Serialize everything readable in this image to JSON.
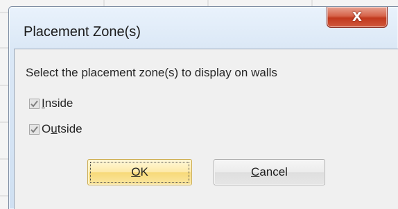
{
  "dialog": {
    "title": "Placement Zone(s)",
    "close_label": "X",
    "prompt": "Select the placement zone(s) to display on walls",
    "options": [
      {
        "label_prefix": "",
        "mnemonic": "I",
        "label_rest": "nside",
        "checked": true
      },
      {
        "label_prefix": "O",
        "mnemonic": "u",
        "label_rest": "tside",
        "checked": true
      }
    ],
    "ok": {
      "mnemonic": "O",
      "rest": "K"
    },
    "cancel": {
      "mnemonic": "C",
      "rest": "ancel"
    }
  },
  "colors": {
    "title_bar": "#dbe8f6",
    "close_button": "#c1391e",
    "ok_button": "#f7d978",
    "body": "#f0f0f0"
  }
}
